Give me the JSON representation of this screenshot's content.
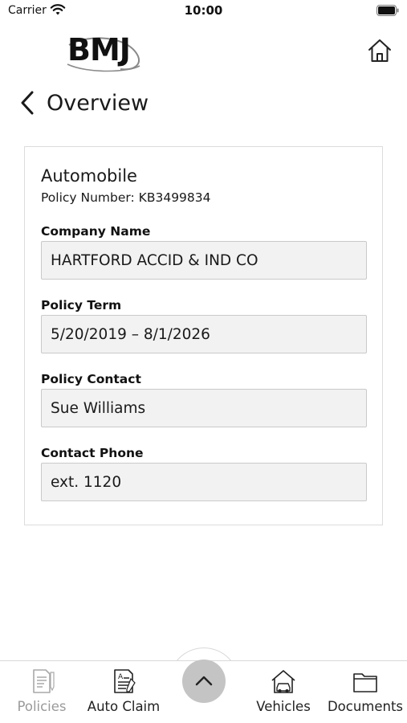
{
  "status_bar": {
    "carrier": "Carrier",
    "time": "10:00"
  },
  "header": {
    "logo_text": "BMJ",
    "back_title": "Overview"
  },
  "policy": {
    "type": "Automobile",
    "number_label": "Policy Number:",
    "number_value": "KB3499834",
    "fields": [
      {
        "label": "Company Name",
        "value": "HARTFORD ACCID & IND CO"
      },
      {
        "label": "Policy Term",
        "value": "5/20/2019 – 8/1/2026"
      },
      {
        "label": "Policy Contact",
        "value": "Sue Williams"
      },
      {
        "label": "Contact Phone",
        "value": "ext. 1120"
      }
    ]
  },
  "tab_bar": {
    "tabs": [
      {
        "label": "Policies",
        "icon": "policies-document-icon",
        "active": false
      },
      {
        "label": "Auto Claim",
        "icon": "auto-claim-form-icon",
        "active": true
      },
      {
        "label": "Vehicles",
        "icon": "vehicles-garage-icon",
        "active": true
      },
      {
        "label": "Documents",
        "icon": "documents-folder-icon",
        "active": true
      }
    ],
    "center_icon": "chevron-up-icon"
  },
  "colors": {
    "field_background": "#f2f2f2",
    "card_border": "#dcdcdc",
    "center_button": "#c4c4c4",
    "inactive_tab": "#9a9a9a"
  }
}
